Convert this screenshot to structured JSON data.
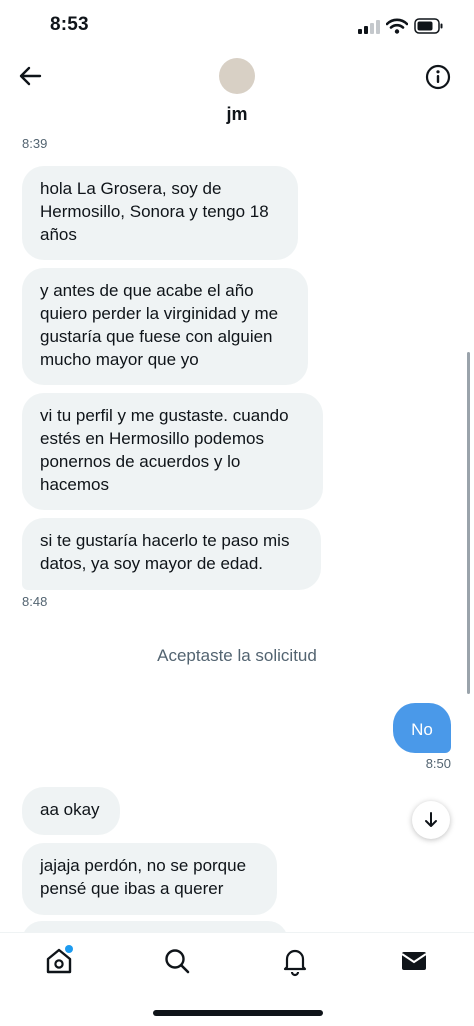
{
  "status_bar": {
    "time": "8:53"
  },
  "header": {
    "contact_name": "jm"
  },
  "conversation": {
    "time_top": "8:39",
    "received_block_1": [
      "hola La Grosera, soy de\nHermosillo, Sonora y tengo 18\naños",
      "y antes de que acabe el año\nquiero perder la virginidad y me\ngustaría que fuese con alguien\nmucho mayor que yo",
      "vi tu perfil y me gustaste. cuando\nestés en Hermosillo podemos\nponernos de acuerdos y lo\nhacemos",
      "si te gustaría hacerlo te paso mis\ndatos, ya soy mayor de edad."
    ],
    "time_block_1": "8:48",
    "system_message": "Aceptaste la solicitud",
    "sent_message": "No",
    "sent_time": "8:50",
    "received_block_2": [
      "aa okay",
      "jajaja perdón, no se porque\npensé que ibas a querer"
    ]
  },
  "icons": {
    "back": "arrow-left-icon",
    "info": "info-icon",
    "scroll_down": "arrow-down-icon",
    "tabs": [
      "home-icon",
      "search-icon",
      "bell-icon",
      "mail-icon"
    ]
  },
  "colors": {
    "sent_bubble": "#4a99e9",
    "received_bubble": "#eff3f4",
    "notification_dot": "#1d9bf0",
    "secondary_text": "#536471"
  }
}
